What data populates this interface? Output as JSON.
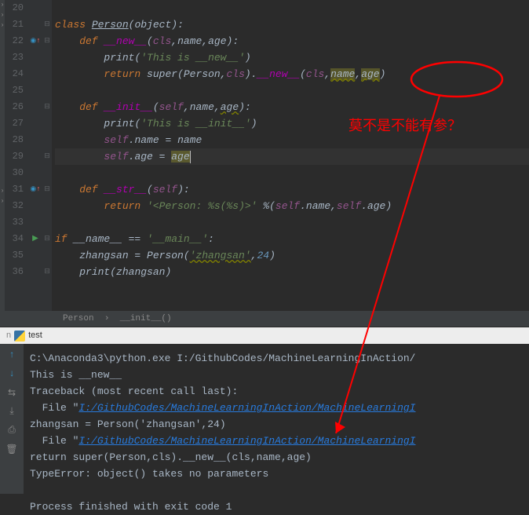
{
  "lines": [
    {
      "n": 20,
      "icon": "",
      "fold": "",
      "html": ""
    },
    {
      "n": 21,
      "icon": "",
      "fold": "⊟",
      "html": "<span class='kw'>class</span> <span class='cls-ref'>Person</span>(<span class='id'>object</span>):"
    },
    {
      "n": 22,
      "icon": "◎↑",
      "fold": "⊟",
      "html": "    <span class='kw'>def</span> <span class='mag'>__new__</span>(<span class='self'>cls</span>,<span class='param'>name</span>,<span class='param'>age</span>):"
    },
    {
      "n": 23,
      "icon": "",
      "fold": "",
      "html": "        <span class='id'>print</span>(<span class='str'>'This is __new__'</span>)"
    },
    {
      "n": 24,
      "icon": "",
      "fold": "",
      "html": "        <span class='kw'>return</span> <span class='id'>super</span>(Person,<span class='self'>cls</span>).<span class='mag'>__new__</span>(<span class='self'>cl</span><span class='self'>s</span>,<span class='usage warn'>name</span>,<span class='usage warn'>age</span>)"
    },
    {
      "n": 25,
      "icon": "",
      "fold": "",
      "html": ""
    },
    {
      "n": 26,
      "icon": "",
      "fold": "⊟",
      "html": "    <span class='kw'>def</span> <span class='mag'>__init__</span>(<span class='self'>self</span>,<span class='param'>name</span>,<span class='param warn'>age</span>):"
    },
    {
      "n": 27,
      "icon": "",
      "fold": "",
      "html": "        <span class='id'>print</span>(<span class='str'>'This is __init__'</span>)"
    },
    {
      "n": 28,
      "icon": "",
      "fold": "",
      "html": "        <span class='self'>self</span>.name = <span class='param'>name</span>"
    },
    {
      "n": 29,
      "icon": "",
      "fold": "⊟",
      "html": "        <span class='self'>self</span>.age = <span class='param usage'>age</span><span class='caret'></span>",
      "hl": true
    },
    {
      "n": 30,
      "icon": "",
      "fold": "",
      "html": ""
    },
    {
      "n": 31,
      "icon": "◎↑",
      "fold": "⊟",
      "html": "    <span class='kw'>def</span> <span class='mag'>__str__</span>(<span class='self'>self</span>):"
    },
    {
      "n": 32,
      "icon": "",
      "fold": "",
      "html": "        <span class='kw'>return</span> <span class='str'>'&lt;Person: %s(%s)&gt;'</span> %(<span class='self'>self</span>.name,<span class='self'>self</span>.age)"
    },
    {
      "n": 33,
      "icon": "",
      "fold": "",
      "html": ""
    },
    {
      "n": 34,
      "icon": "▶",
      "fold": "⊟",
      "html": "<span class='kw'>if</span> __name__ == <span class='str'>'__main__'</span>:"
    },
    {
      "n": 35,
      "icon": "",
      "fold": "",
      "html": "    zhangsan = Person(<span class='str warn'>'zhangsan'</span>,<span class='num'>24</span>)"
    },
    {
      "n": 36,
      "icon": "",
      "fold": "⊟",
      "html": "    <span class='id'>print</span>(zhangsan)"
    },
    {
      "n": "",
      "icon": "",
      "fold": "",
      "html": ""
    }
  ],
  "breadcrumb": {
    "cls": "Person",
    "fn": "__init__()",
    "sep": "›"
  },
  "tab": {
    "name": "test"
  },
  "annotation": "莫不是不能有参？",
  "tools": {
    "up": "↑",
    "down": "↓",
    "wrap": "⇆",
    "scroll": "⤓",
    "print": "⎙",
    "trash": "🗑"
  },
  "console": [
    {
      "t": "C:\\Anaconda3\\python.exe I:/GithubCodes/MachineLearningInAction/"
    },
    {
      "t": "This is __new__"
    },
    {
      "t": "Traceback (most recent call last):"
    },
    {
      "t": "  File \"",
      "a": "I:/GithubCodes/MachineLearningInAction/MachineLearningI"
    },
    {
      "t": "    zhangsan = Person('zhangsan',24)"
    },
    {
      "t": "  File \"",
      "a": "I:/GithubCodes/MachineLearningInAction/MachineLearningI"
    },
    {
      "t": "    return super(Person,cls).__new__(cls,name,age)"
    },
    {
      "t": "TypeError: object() takes no parameters"
    },
    {
      "t": ""
    },
    {
      "t": "Process finished with exit code 1"
    }
  ]
}
